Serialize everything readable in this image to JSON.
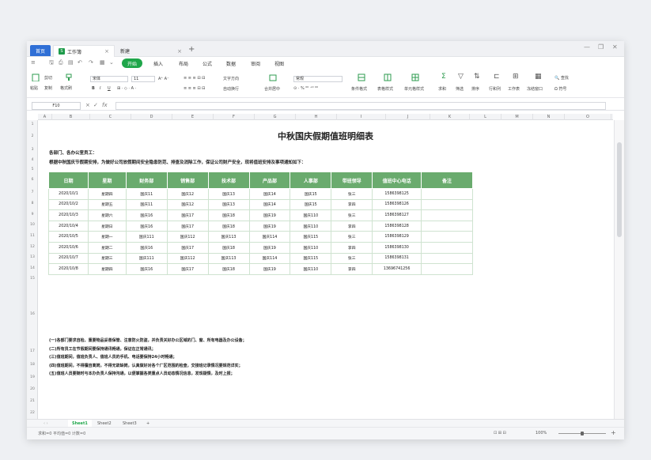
{
  "tabs": {
    "home": "首页",
    "file": "工作簿",
    "new": "新建"
  },
  "menu": [
    "≡",
    "开始",
    "插入",
    "布局",
    "公式",
    "数据",
    "审阅",
    "视图"
  ],
  "ribbon": {
    "paste": "粘贴",
    "cut": "剪切",
    "copy": "复制",
    "format_painter": "格式刷",
    "font_name": "宋体",
    "font_size": "11",
    "number_format": "常规",
    "wrap": "文字方向",
    "merge": "自动换行",
    "merge_center": "合并居中",
    "cond_format": "条件格式",
    "table_style": "表格样式",
    "cell_style": "单元格样式",
    "sum": "求和",
    "filter": "筛选",
    "sort": "排序",
    "rowcol": "行和列",
    "worksheet": "工作表",
    "freeze": "冻结窗口",
    "find": "查找",
    "symbol": "符号"
  },
  "formula": {
    "cell": "F10",
    "fx": "fx"
  },
  "columns": [
    "A",
    "B",
    "C",
    "D",
    "E",
    "F",
    "G",
    "H",
    "I",
    "J",
    "K",
    "L",
    "M",
    "N",
    "O"
  ],
  "title": "中秋国庆假期值班明细表",
  "intro_1": "各部门、各办公室员工：",
  "intro_2": "根据中秋国庆节假期安排，为做好公司放假期间安全隐患防范、排查及消除工作，保证公司财产安全，现将值班安排及事项通知如下：",
  "table": {
    "headers": [
      "日期",
      "星期",
      "财务部",
      "销售部",
      "技术部",
      "产品部",
      "人事部",
      "带班领导",
      "值班中心电话",
      "备注"
    ],
    "rows": [
      [
        "2020/10/1",
        "星期四",
        "国庆11",
        "国庆12",
        "国庆13",
        "国庆14",
        "国庆15",
        "张三",
        "1586398125",
        ""
      ],
      [
        "2020/10/2",
        "星期五",
        "国庆11",
        "国庆12",
        "国庆13",
        "国庆14",
        "国庆15",
        "李四",
        "1586398126",
        ""
      ],
      [
        "2020/10/3",
        "星期六",
        "国庆16",
        "国庆17",
        "国庆18",
        "国庆19",
        "国庆110",
        "张三",
        "1586398127",
        ""
      ],
      [
        "2020/10/4",
        "星期日",
        "国庆16",
        "国庆17",
        "国庆18",
        "国庆19",
        "国庆110",
        "李四",
        "1586398128",
        ""
      ],
      [
        "2020/10/5",
        "星期一",
        "国庆111",
        "国庆112",
        "国庆113",
        "国庆114",
        "国庆115",
        "张三",
        "1586398129",
        ""
      ],
      [
        "2020/10/6",
        "星期二",
        "国庆16",
        "国庆17",
        "国庆18",
        "国庆19",
        "国庆110",
        "李四",
        "1586398130",
        ""
      ],
      [
        "2020/10/7",
        "星期三",
        "国庆111",
        "国庆112",
        "国庆113",
        "国庆114",
        "国庆115",
        "张三",
        "1586398131",
        ""
      ],
      [
        "2020/10/8",
        "星期四",
        "国庆16",
        "国庆17",
        "国庆18",
        "国庆19",
        "国庆110",
        "李四",
        "13696741256",
        ""
      ]
    ]
  },
  "notes": [
    "(一)各部门要求自检、重要物品妥善保管、注意防火防盗，并负责关好办公区域的门、窗、所有电器及办公设备；",
    "(二)所有员工在节假期间要保持通讯畅通，保证在正常通讯；",
    "(三)值班期间，值班负责人、值班人员的手机、电话要保持24小时畅通；",
    "(四)值班期间，不得擅自离岗，不得无故缺岗，认真做好对各个厂区范围的检查，交接班记录情况要规范详实；",
    "(五)值班人员要随时与本办负责人保持沟通，以便掌握各类重点人员动态情况信息，发现疑情，及时上报；"
  ],
  "sheets": [
    "Sheet1",
    "Sheet2",
    "Sheet3"
  ],
  "status": "求和=0  平均值=0  计数=0",
  "zoom": "100%"
}
